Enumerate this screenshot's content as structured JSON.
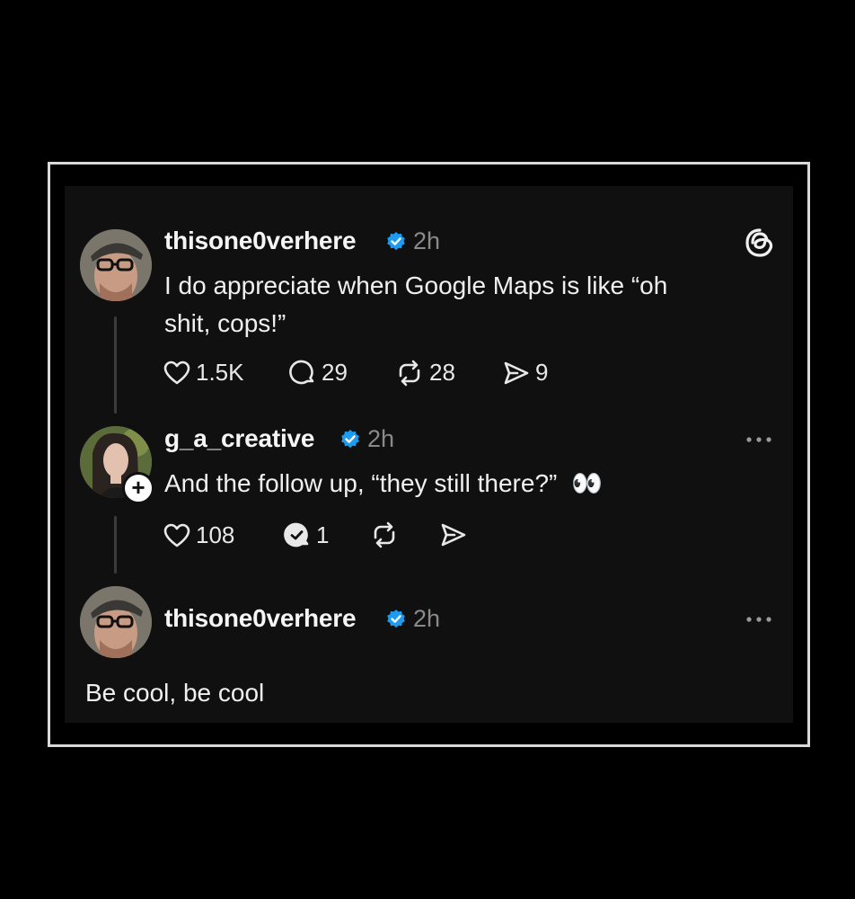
{
  "colors": {
    "background": "#000000",
    "card": "#101010",
    "frame_border": "#d9d9d9",
    "verified_blue": "#1d9bf0",
    "muted_text": "#8a8a8a"
  },
  "posts": [
    {
      "username": "thisone0verhere",
      "verified": true,
      "time": "2h",
      "text_line1": "I do appreciate when Google Maps is like “oh",
      "text_line2": "shit, cops!”",
      "likes": "1.5K",
      "replies": "29",
      "reposts": "28",
      "shares": "9",
      "corner_icon": "threads-logo-icon"
    },
    {
      "username": "g_a_creative",
      "verified": true,
      "time": "2h",
      "text": "And the follow up, “they still there?”",
      "emoji": "👀",
      "likes": "108",
      "replies": "1",
      "follow_badge": "+",
      "corner_icon": "more-options-icon"
    },
    {
      "username": "thisone0verhere",
      "verified": true,
      "time": "2h",
      "text": "Be cool, be cool",
      "corner_icon": "more-options-icon"
    }
  ]
}
